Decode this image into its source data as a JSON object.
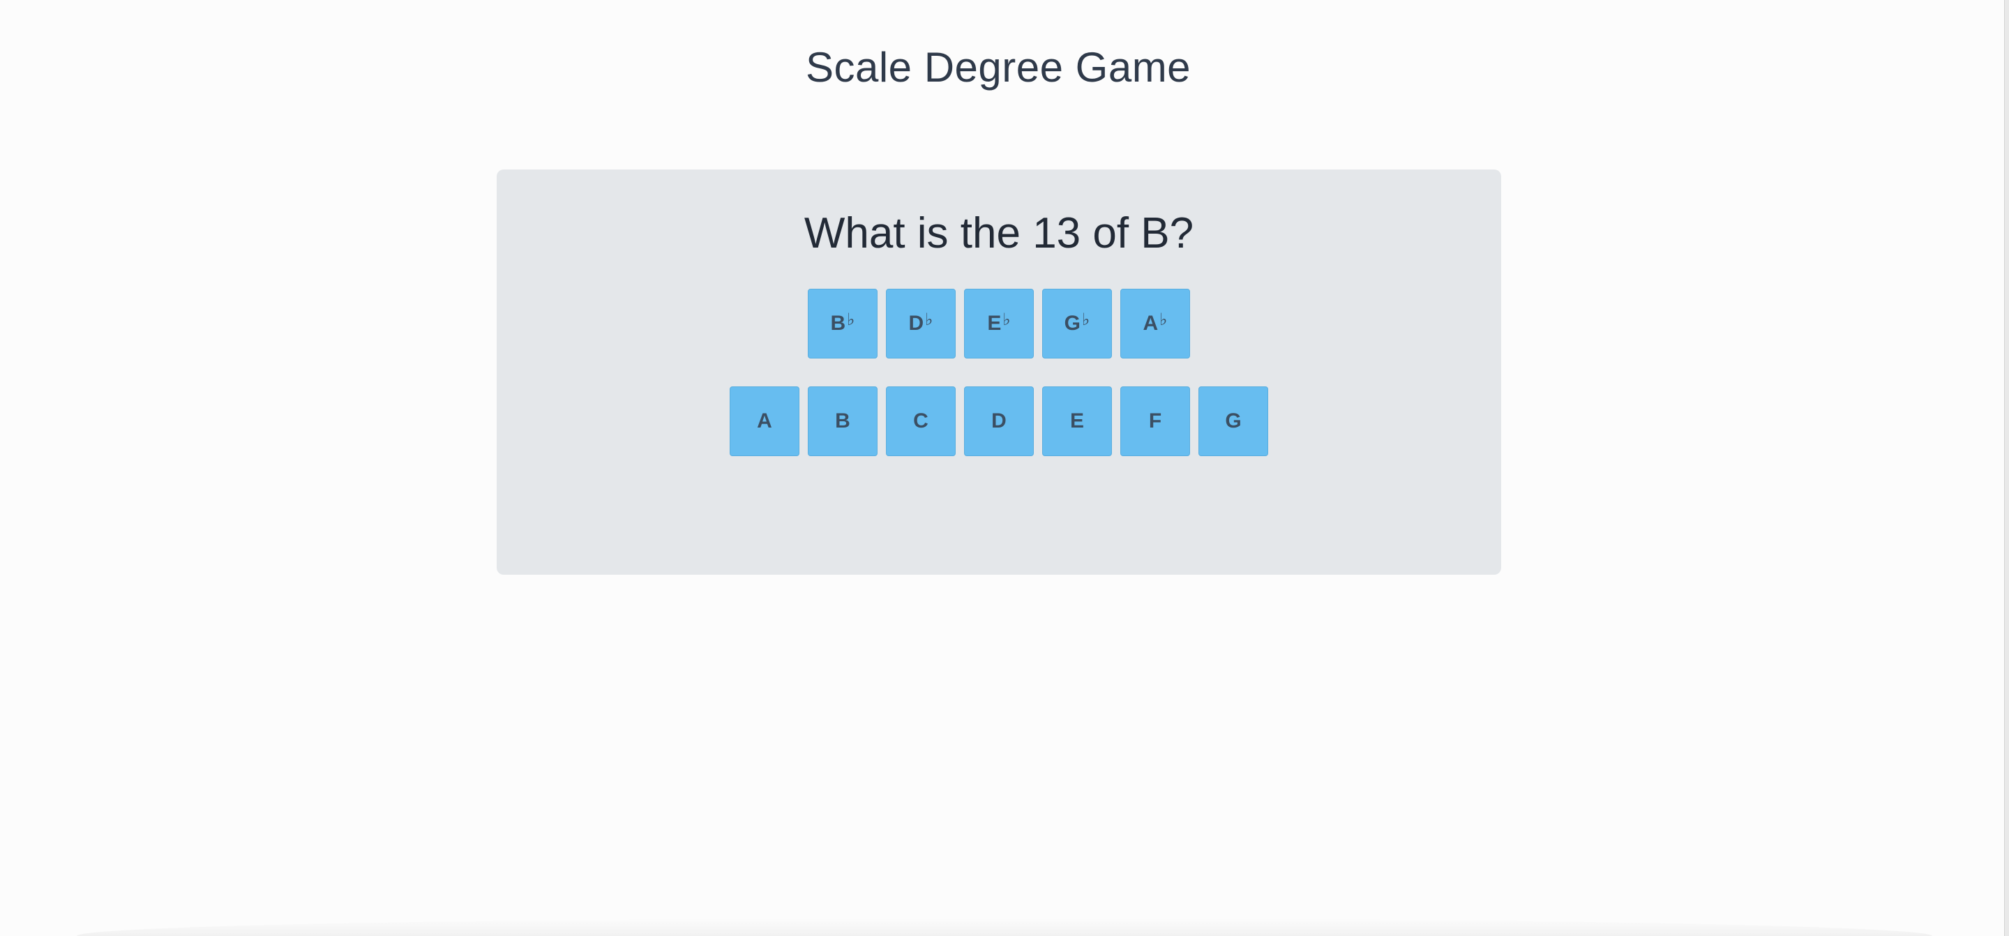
{
  "header": {
    "title": "Scale Degree Game"
  },
  "game": {
    "question": "What is the 13 of B?",
    "flat_notes": [
      {
        "letter": "B",
        "accidental": "♭"
      },
      {
        "letter": "D",
        "accidental": "♭"
      },
      {
        "letter": "E",
        "accidental": "♭"
      },
      {
        "letter": "G",
        "accidental": "♭"
      },
      {
        "letter": "A",
        "accidental": "♭"
      }
    ],
    "natural_notes": [
      {
        "letter": "A"
      },
      {
        "letter": "B"
      },
      {
        "letter": "C"
      },
      {
        "letter": "D"
      },
      {
        "letter": "E"
      },
      {
        "letter": "F"
      },
      {
        "letter": "G"
      }
    ]
  },
  "colors": {
    "background": "#fcfcfc",
    "card": "#e4e7ea",
    "button": "#67bdf0",
    "button_text": "#3b4f63",
    "title_text": "#2f3a4a"
  }
}
